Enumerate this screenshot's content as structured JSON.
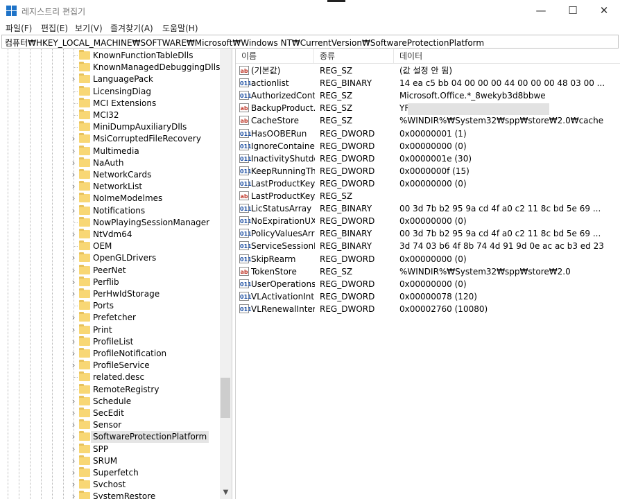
{
  "window": {
    "title": "레지스트리 편집기",
    "minimize": "—",
    "maximize": "☐",
    "close": "✕"
  },
  "menu": [
    "파일(F)",
    "편집(E)",
    "보기(V)",
    "즐겨찾기(A)",
    "도움말(H)"
  ],
  "address": "컴퓨터₩HKEY_LOCAL_MACHINE₩SOFTWARE₩Microsoft₩Windows NT₩CurrentVersion₩SoftwareProtectionPlatform",
  "tree": {
    "items": [
      {
        "label": "KnownFunctionTableDlls",
        "expandable": false
      },
      {
        "label": "KnownManagedDebuggingDlls",
        "expandable": false
      },
      {
        "label": "LanguagePack",
        "expandable": true
      },
      {
        "label": "LicensingDiag",
        "expandable": false
      },
      {
        "label": "MCI Extensions",
        "expandable": false
      },
      {
        "label": "MCI32",
        "expandable": false
      },
      {
        "label": "MiniDumpAuxiliaryDlls",
        "expandable": false
      },
      {
        "label": "MsiCorruptedFileRecovery",
        "expandable": true
      },
      {
        "label": "Multimedia",
        "expandable": true
      },
      {
        "label": "NaAuth",
        "expandable": true
      },
      {
        "label": "NetworkCards",
        "expandable": true
      },
      {
        "label": "NetworkList",
        "expandable": true
      },
      {
        "label": "NoImeModelmes",
        "expandable": true
      },
      {
        "label": "Notifications",
        "expandable": true
      },
      {
        "label": "NowPlayingSessionManager",
        "expandable": false
      },
      {
        "label": "NtVdm64",
        "expandable": true
      },
      {
        "label": "OEM",
        "expandable": false
      },
      {
        "label": "OpenGLDrivers",
        "expandable": true
      },
      {
        "label": "PeerNet",
        "expandable": true
      },
      {
        "label": "Perflib",
        "expandable": true
      },
      {
        "label": "PerHwIdStorage",
        "expandable": true
      },
      {
        "label": "Ports",
        "expandable": false
      },
      {
        "label": "Prefetcher",
        "expandable": true
      },
      {
        "label": "Print",
        "expandable": true
      },
      {
        "label": "ProfileList",
        "expandable": true
      },
      {
        "label": "ProfileNotification",
        "expandable": true
      },
      {
        "label": "ProfileService",
        "expandable": true
      },
      {
        "label": "related.desc",
        "expandable": false
      },
      {
        "label": "RemoteRegistry",
        "expandable": false
      },
      {
        "label": "Schedule",
        "expandable": true
      },
      {
        "label": "SecEdit",
        "expandable": true
      },
      {
        "label": "Sensor",
        "expandable": true
      },
      {
        "label": "SoftwareProtectionPlatform",
        "expandable": true,
        "selected": true
      },
      {
        "label": "SPP",
        "expandable": true
      },
      {
        "label": "SRUM",
        "expandable": true
      },
      {
        "label": "Superfetch",
        "expandable": true
      },
      {
        "label": "Svchost",
        "expandable": true
      },
      {
        "label": "SystemRestore",
        "expandable": true
      }
    ],
    "scroll_down_icon": "▼"
  },
  "list": {
    "columns": [
      "이름",
      "종류",
      "데이터"
    ],
    "rows": [
      {
        "icon": "sz",
        "name": "(기본값)",
        "type": "REG_SZ",
        "data": "(값 설정 안 됨)"
      },
      {
        "icon": "bin",
        "name": "actionlist",
        "type": "REG_BINARY",
        "data": "14 ea c5 bb 04 00 00 00 44 00 00 00 48 03 00 ..."
      },
      {
        "icon": "bin",
        "name": "AuthorizedCont...",
        "type": "REG_SZ",
        "data": "Microsoft.Office.*_8wekyb3d8bbwe"
      },
      {
        "icon": "sz",
        "name": "BackupProduct...",
        "type": "REG_SZ",
        "data": "YR"
      },
      {
        "icon": "sz",
        "name": "CacheStore",
        "type": "REG_SZ",
        "data": "%WINDIR%₩System32₩spp₩store₩2.0₩cache"
      },
      {
        "icon": "bin",
        "name": "HasOOBERun",
        "type": "REG_DWORD",
        "data": "0x00000001 (1)"
      },
      {
        "icon": "bin",
        "name": "IgnoreContainer...",
        "type": "REG_DWORD",
        "data": "0x00000000 (0)"
      },
      {
        "icon": "bin",
        "name": "InactivityShutdo...",
        "type": "REG_DWORD",
        "data": "0x0000001e (30)"
      },
      {
        "icon": "bin",
        "name": "KeepRunningTh...",
        "type": "REG_DWORD",
        "data": "0x0000000f (15)"
      },
      {
        "icon": "bin",
        "name": "LastProductKey...",
        "type": "REG_DWORD",
        "data": "0x00000000 (0)"
      },
      {
        "icon": "sz",
        "name": "LastProductKey...",
        "type": "REG_SZ",
        "data": ""
      },
      {
        "icon": "bin",
        "name": "LicStatusArray",
        "type": "REG_BINARY",
        "data": "00 3d 7b b2 95 9a cd 4f a0 c2 11 8c bd 5e 69 ..."
      },
      {
        "icon": "bin",
        "name": "NoExpirationUX",
        "type": "REG_DWORD",
        "data": "0x00000000 (0)"
      },
      {
        "icon": "bin",
        "name": "PolicyValuesArray",
        "type": "REG_BINARY",
        "data": "00 3d 7b b2 95 9a cd 4f a0 c2 11 8c bd 5e 69 ..."
      },
      {
        "icon": "bin",
        "name": "ServiceSessionId",
        "type": "REG_BINARY",
        "data": "3d 74 03 b6 4f 8b 74 4d 91 9d 0e ac ac b3 ed 23"
      },
      {
        "icon": "bin",
        "name": "SkipRearm",
        "type": "REG_DWORD",
        "data": "0x00000000 (0)"
      },
      {
        "icon": "sz",
        "name": "TokenStore",
        "type": "REG_SZ",
        "data": "%WINDIR%₩System32₩spp₩store₩2.0"
      },
      {
        "icon": "bin",
        "name": "UserOperations",
        "type": "REG_DWORD",
        "data": "0x00000000 (0)"
      },
      {
        "icon": "bin",
        "name": "VLActivationInt...",
        "type": "REG_DWORD",
        "data": "0x00000078 (120)"
      },
      {
        "icon": "bin",
        "name": "VLRenewalInter...",
        "type": "REG_DWORD",
        "data": "0x00002760 (10080)"
      }
    ]
  },
  "icons": {
    "string_value": "ab",
    "binary_value": "011",
    "expander": "›",
    "folder": "folder-icon"
  }
}
